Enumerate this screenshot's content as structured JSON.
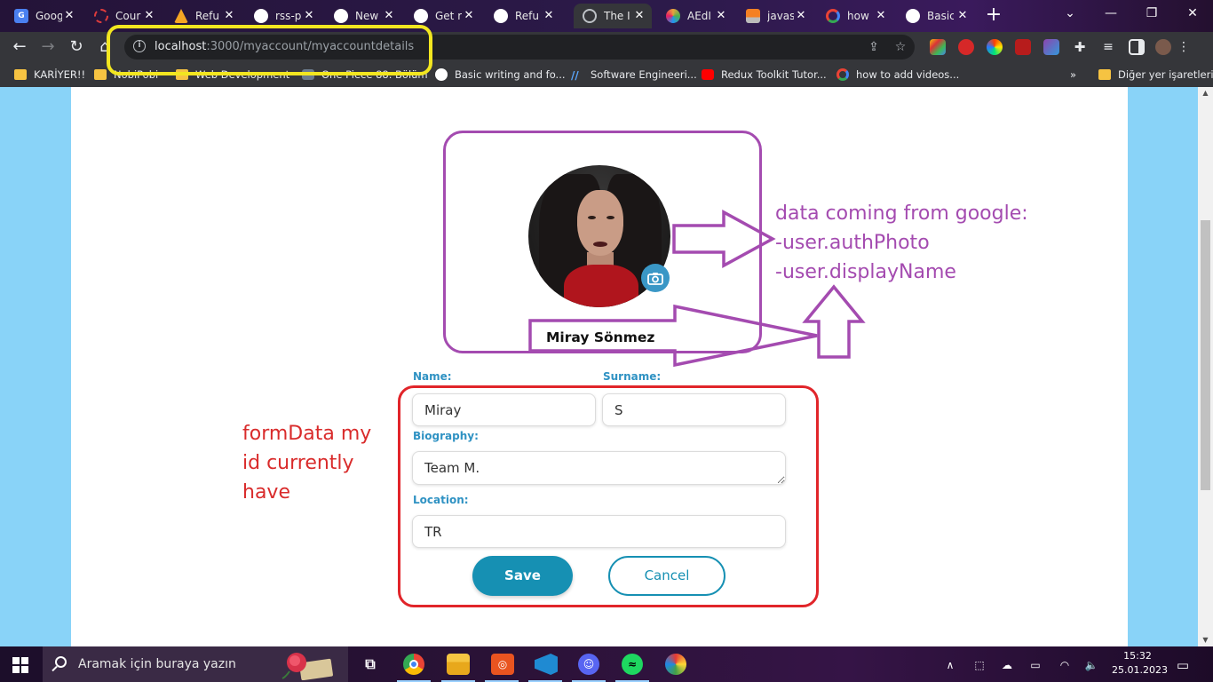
{
  "browser": {
    "tabs": [
      {
        "title": "Goog",
        "favicon": "google-docs-icon",
        "color": "#4a80f0"
      },
      {
        "title": "Cour",
        "favicon": "coursera-icon",
        "color": "#e03c3c"
      },
      {
        "title": "Refu",
        "favicon": "firebase-icon",
        "color": "#f5a623"
      },
      {
        "title": "rss-p",
        "favicon": "github-icon",
        "color": "#ffffff"
      },
      {
        "title": "New",
        "favicon": "github-icon",
        "color": "#ffffff"
      },
      {
        "title": "Get r",
        "favicon": "github-icon",
        "color": "#ffffff"
      },
      {
        "title": "Refu",
        "favicon": "github-icon",
        "color": "#ffffff"
      },
      {
        "title": "The I",
        "favicon": "globe-icon",
        "color": "#bdc1c6",
        "active": true
      },
      {
        "title": "AEdI",
        "favicon": "pinwheel-icon",
        "color": "#e8a33c"
      },
      {
        "title": "javas",
        "favicon": "stackoverflow-icon",
        "color": "#f48024"
      },
      {
        "title": "how",
        "favicon": "google-icon",
        "color": "#ffffff"
      },
      {
        "title": "Basic",
        "favicon": "github-icon",
        "color": "#ffffff"
      }
    ],
    "url_host": "localhost",
    "url_path": ":3000/myaccount/myaccountdetails",
    "bookmarks": [
      {
        "label": "KARİYER!!",
        "icon": "folder-icon"
      },
      {
        "label": "NobiPobi",
        "icon": "folder-icon"
      },
      {
        "label": "Web Development",
        "icon": "folder-icon"
      },
      {
        "label": "One Piece 88. Bölüm",
        "icon": "onepiece-icon"
      },
      {
        "label": "Basic writing and fo...",
        "icon": "github-icon"
      },
      {
        "label": "Software Engineeri...",
        "icon": "software-engineering-icon"
      },
      {
        "label": "Redux Toolkit Tutor...",
        "icon": "youtube-icon"
      },
      {
        "label": "how to add videos...",
        "icon": "google-icon"
      }
    ],
    "bookmarks_overflow": "»",
    "other_bookmarks": "Diğer yer işaretleri"
  },
  "profile": {
    "display_name": "Miray Sönmez"
  },
  "form": {
    "name_label": "Name:",
    "surname_label": "Surname:",
    "biography_label": "Biography:",
    "location_label": "Location:",
    "name_value": "Miray",
    "surname_value": "S",
    "biography_value": "Team M.",
    "location_value": "TR",
    "save_label": "Save",
    "cancel_label": "Cancel"
  },
  "annotations": {
    "google_lines": [
      "data coming from google:",
      "-user.authPhoto",
      "-user.displayName"
    ],
    "formdata_lines": [
      "formData my",
      "id currently",
      "have"
    ],
    "purple": "#a44bb0",
    "red": "#e1252a",
    "yellow": "#f2e620"
  },
  "taskbar": {
    "search_placeholder": "Aramak için buraya yazın",
    "time": "15:32",
    "date": "25.01.2023",
    "apps": [
      "task-view-icon",
      "chrome-icon",
      "file-explorer-icon",
      "ubuntu-icon",
      "vscode-icon",
      "discord-icon",
      "spotify-icon",
      "paint-icon"
    ]
  },
  "colors": {
    "accent": "#1690b3",
    "label_blue": "#2f92c3",
    "page_side": "#89d3f8"
  }
}
